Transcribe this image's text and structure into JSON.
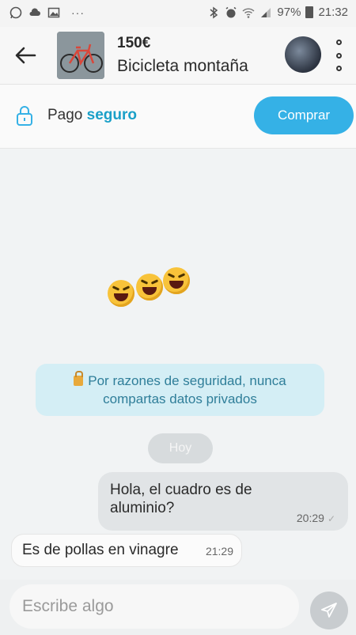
{
  "status_bar": {
    "left_icons": [
      "whatsapp-icon",
      "cloud-icon",
      "image-icon"
    ],
    "overflow": "···",
    "battery_percent": "97%",
    "time": "21:32"
  },
  "header": {
    "price": "150€",
    "title": "Bicicleta montaña",
    "back_icon": "arrow-left-icon",
    "menu_icon": "kebab-menu-icon"
  },
  "pay_bar": {
    "label": "Pago",
    "label_accent": "seguro",
    "buy_label": "Comprar",
    "accent_color": "#1aa0c8",
    "button_color": "#35b1e6"
  },
  "chat": {
    "emoji_count": 3,
    "security_notice_line1": "Por razones de seguridad, nunca",
    "security_notice_line2": "compartas datos privados",
    "day_label": "Hoy",
    "messages": [
      {
        "direction": "outgoing",
        "text": "Hola, el cuadro es de aluminio?",
        "time": "20:29"
      },
      {
        "direction": "incoming",
        "text": "Es de pollas en vinagre",
        "time": "21:29"
      }
    ]
  },
  "composer": {
    "placeholder": "Escribe algo",
    "send_icon": "send-icon"
  }
}
